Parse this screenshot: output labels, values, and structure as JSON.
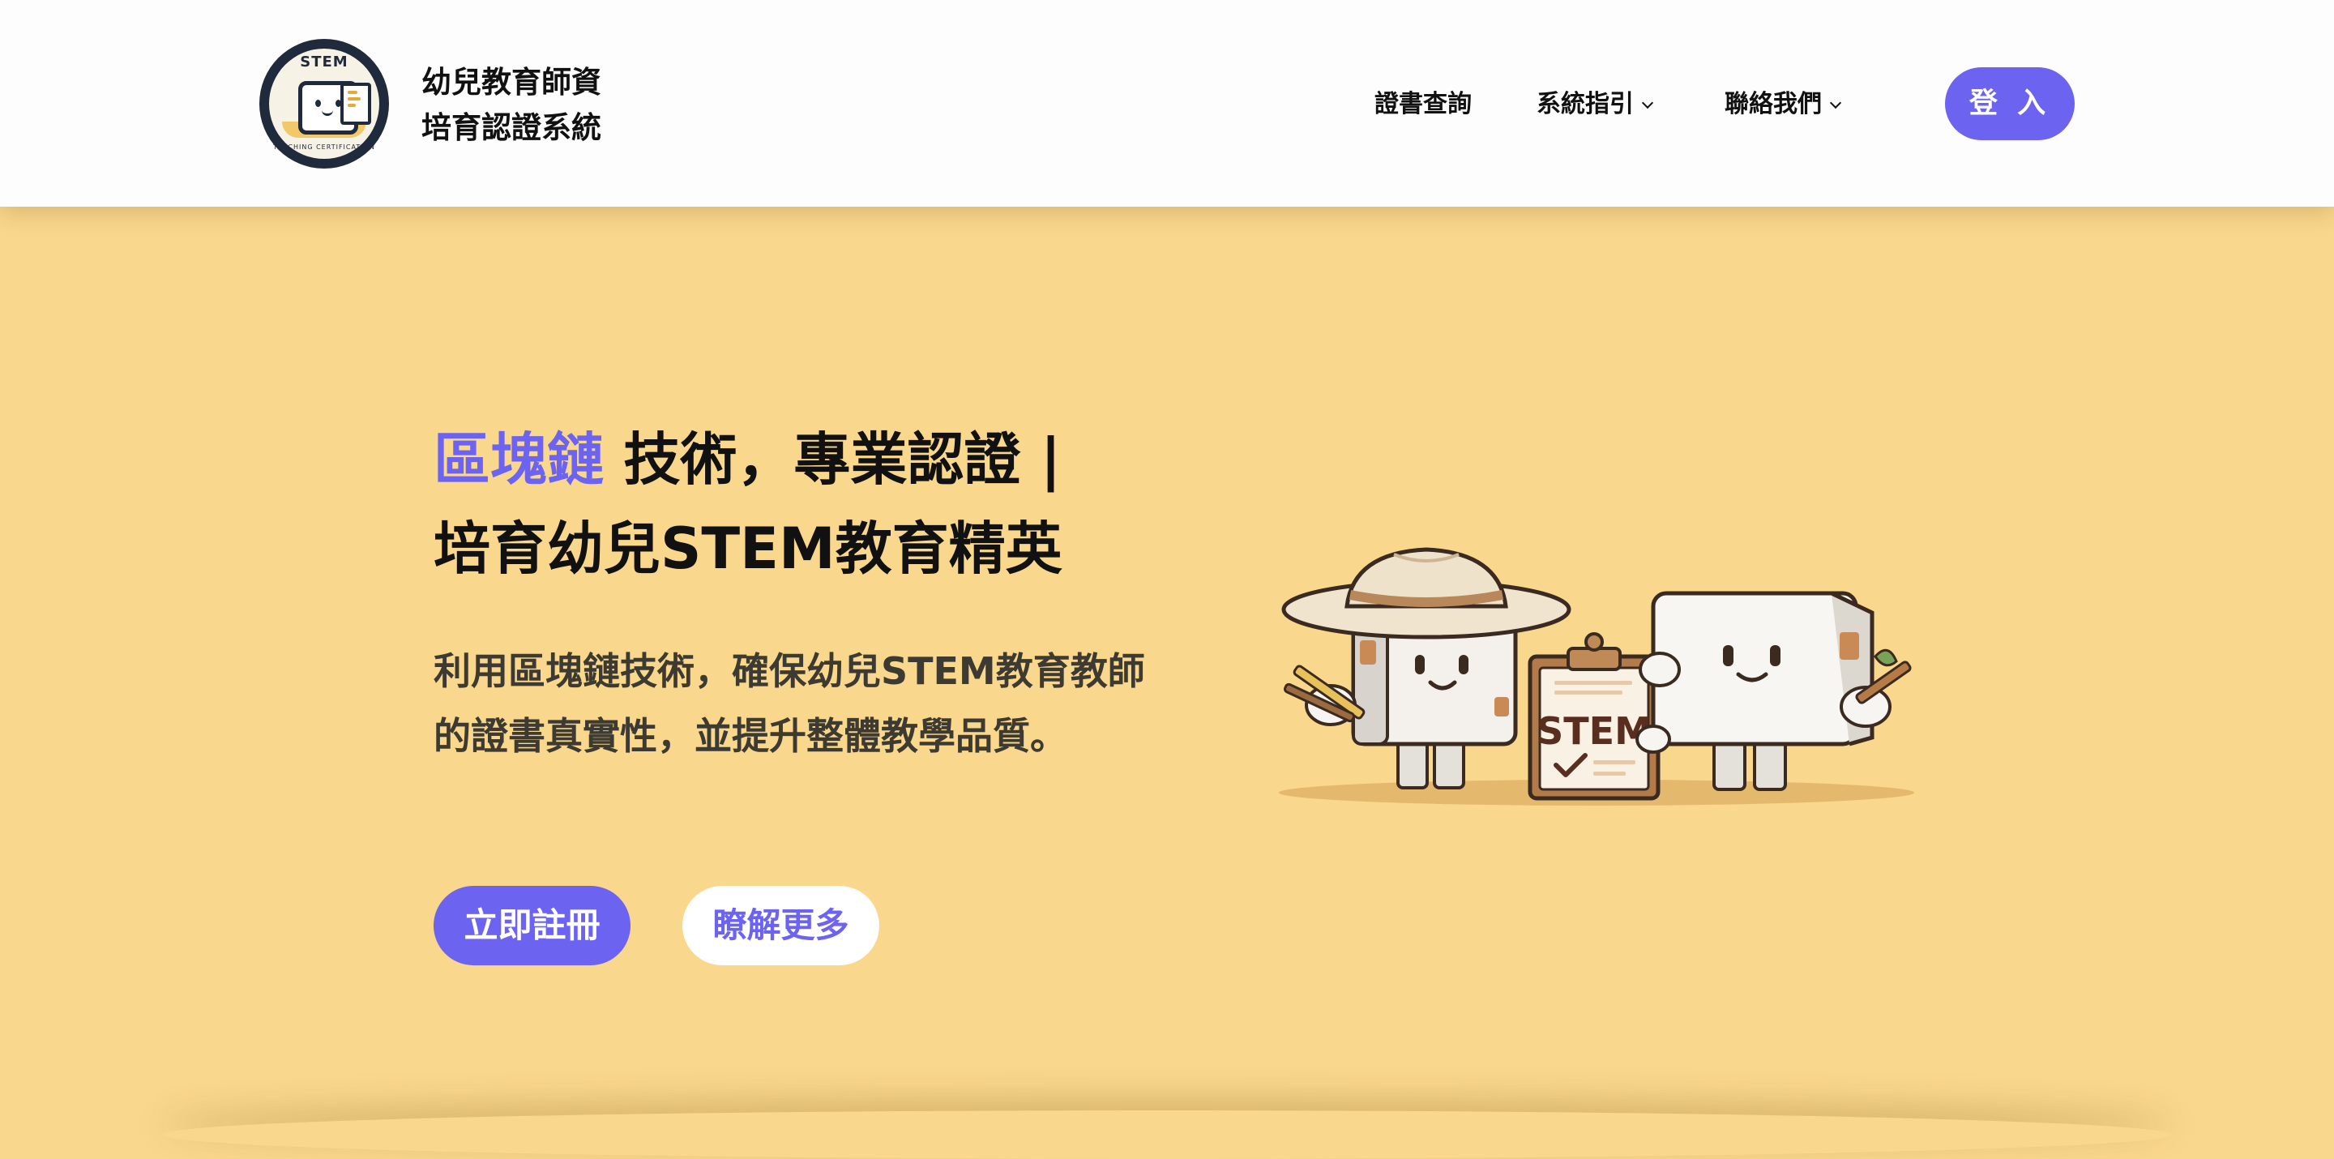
{
  "header": {
    "logo": {
      "badge_text": "STEM",
      "arc_text": "TEACHING CERTIFICATION"
    },
    "brand": {
      "line1": "幼兒教育師資",
      "line2": "培育認證系統"
    },
    "nav": {
      "certificate_lookup": "證書查詢",
      "system_guide": "系統指引",
      "contact_us": "聯絡我們"
    },
    "login_label": "登 入"
  },
  "hero": {
    "title_accent": "區塊鏈",
    "title_rest": " 技術，專業認證 |",
    "title_line2": "培育幼兒STEM教育精英",
    "description": "利用區塊鏈技術，確保幼兒STEM教育教師的證書真實性，並提升整體教學品質。",
    "register_label": "立即註冊",
    "learn_more_label": "瞭解更多",
    "illustration_sign_text": "STEM"
  },
  "colors": {
    "accent": "#6c63f0",
    "hero_background": "#f9d78c",
    "header_background": "#fdfdfd"
  }
}
